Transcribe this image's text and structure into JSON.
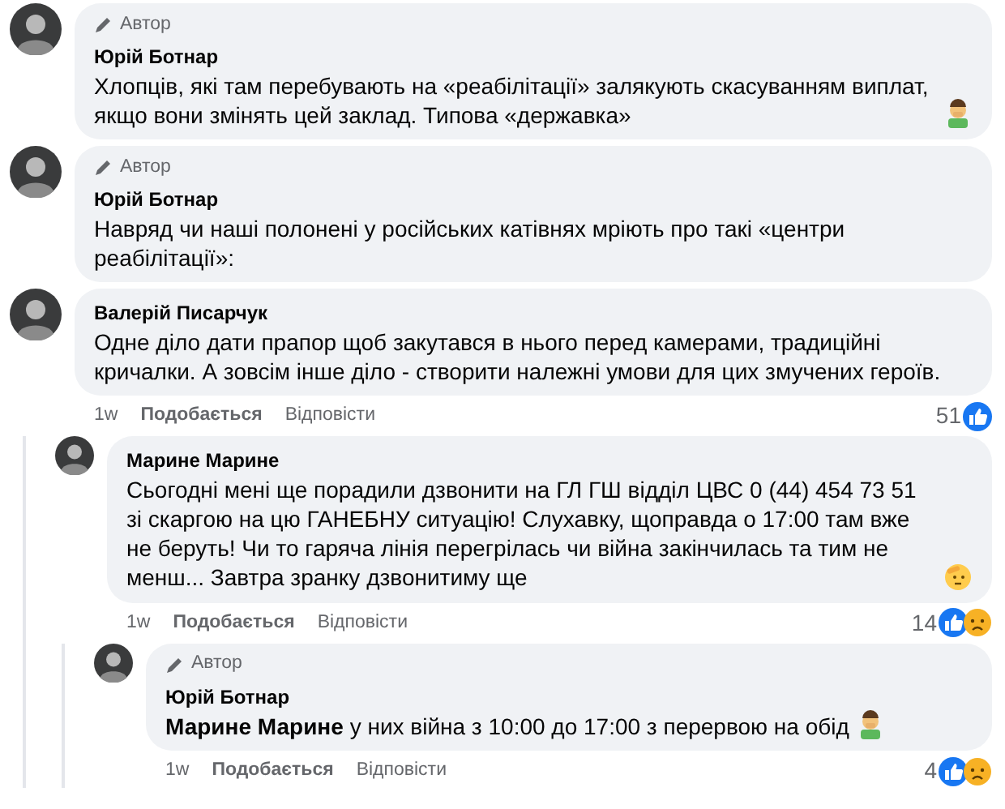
{
  "comments": [
    {
      "author_badge": "Автор",
      "author": "Юрій Ботнар",
      "text": "Хлопців, які там перебувають на «реабілітації» залякують скасуванням виплат, якщо вони змінять цей заклад. Типова «державка»",
      "emoji": {
        "kind": "facepalm"
      }
    },
    {
      "author_badge": "Автор",
      "author": "Юрій Ботнар",
      "text": "Навряд чи наші полонені у російських катівнях мріють про такі «центри реабілітації»:"
    },
    {
      "author": "Валерій Писарчук",
      "text": "Одне діло дати прапор щоб закутався в нього перед камерами, традиційні кричалки. А зовсім інше діло - створити належні умови для цих змучених героїв.",
      "time": "1w",
      "like": "Подобається",
      "reply": "Відповісти",
      "count": "51",
      "reactions": [
        {
          "kind": "like"
        }
      ],
      "children": [
        {
          "author": "Марине Марине",
          "text": "Сьогодні мені ще порадили дзвонити на ГЛ ГШ відділ ЦВС 0 (44) 454 73 51 зі скаргою на цю ГАНЕБНУ ситуацію! Слухавку, щоправда о 17:00 там вже не беруть! Чи то гаряча лінія перегрілась чи війна закінчилась та тим не менш... Завтра зранку дзвонитиму ще",
          "emoji": {
            "kind": "salute"
          },
          "time": "1w",
          "like": "Подобається",
          "reply": "Відповісти",
          "count": "14",
          "reactions": [
            {
              "kind": "like"
            },
            {
              "kind": "sad"
            }
          ],
          "children": [
            {
              "author_badge": "Автор",
              "author": "Юрій Ботнар",
              "text": "**Марине Марине** у них війна з 10:00 до 17:00 з перервою на обід",
              "emoji": {
                "kind": "facepalm"
              },
              "time": "1w",
              "like": "Подобається",
              "reply": "Відповісти",
              "count": "4",
              "reactions": [
                {
                  "kind": "like"
                },
                {
                  "kind": "sad"
                }
              ]
            }
          ]
        }
      ]
    }
  ]
}
